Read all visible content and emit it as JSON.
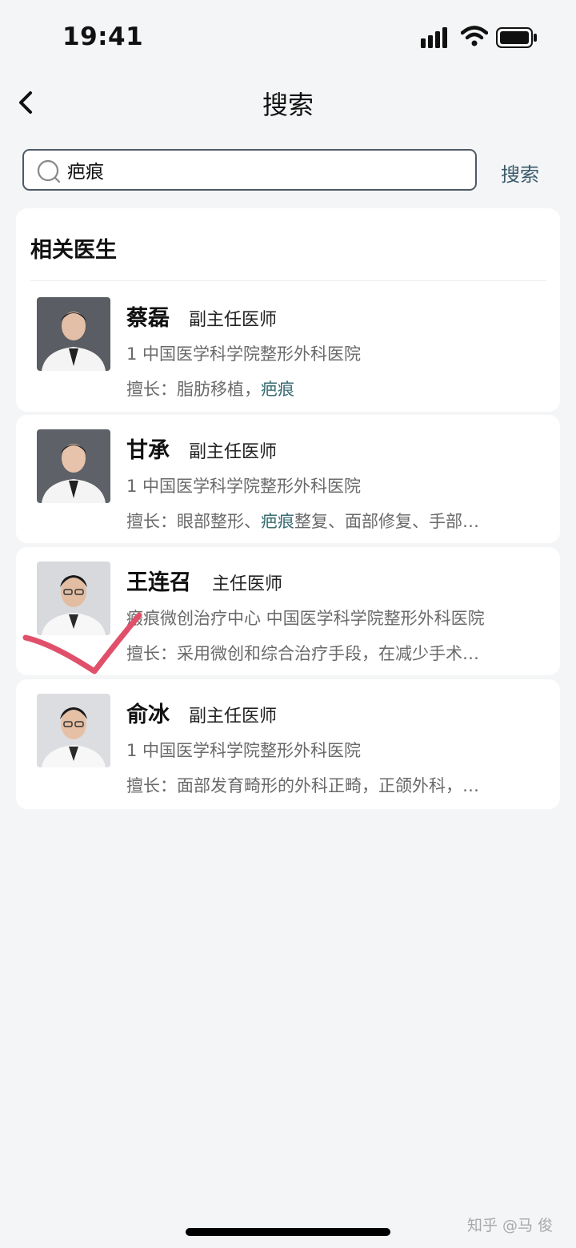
{
  "status_bar": {
    "time": "19:41"
  },
  "nav": {
    "title": "搜索"
  },
  "search": {
    "query": "疤痕",
    "button_label": "搜索"
  },
  "section": {
    "title": "相关医生"
  },
  "doctors": [
    {
      "name": "蔡磊",
      "title": "副主任医师",
      "info": "1  中国医学科学院整形外科医院",
      "specialty_prefix": "擅长：脂肪移植，",
      "specialty_highlight": "疤痕",
      "specialty_rest": ""
    },
    {
      "name": "甘承",
      "title": "副主任医师",
      "info": "1  中国医学科学院整形外科医院",
      "specialty_prefix": "擅长：眼部整形、",
      "specialty_highlight": "疤痕",
      "specialty_rest": "整复、面部修复、手部…"
    },
    {
      "name": "王连召",
      "title": "主任医师",
      "info": "瘢痕微创治疗中心   中国医学科学院整形外科医院",
      "specialty_prefix": "擅长：采用微创和综合治疗手段，在减少手术…",
      "specialty_highlight": "",
      "specialty_rest": ""
    },
    {
      "name": "俞冰",
      "title": "副主任医师",
      "info": "1  中国医学科学院整形外科医院",
      "specialty_prefix": "擅长：面部发育畸形的外科正畸，正颌外科，…",
      "specialty_highlight": "",
      "specialty_rest": ""
    }
  ],
  "watermark": "知乎 @马 俊",
  "colors": {
    "accent": "#3b6d73",
    "checkmark": "#e0506a",
    "background": "#f4f5f6"
  }
}
